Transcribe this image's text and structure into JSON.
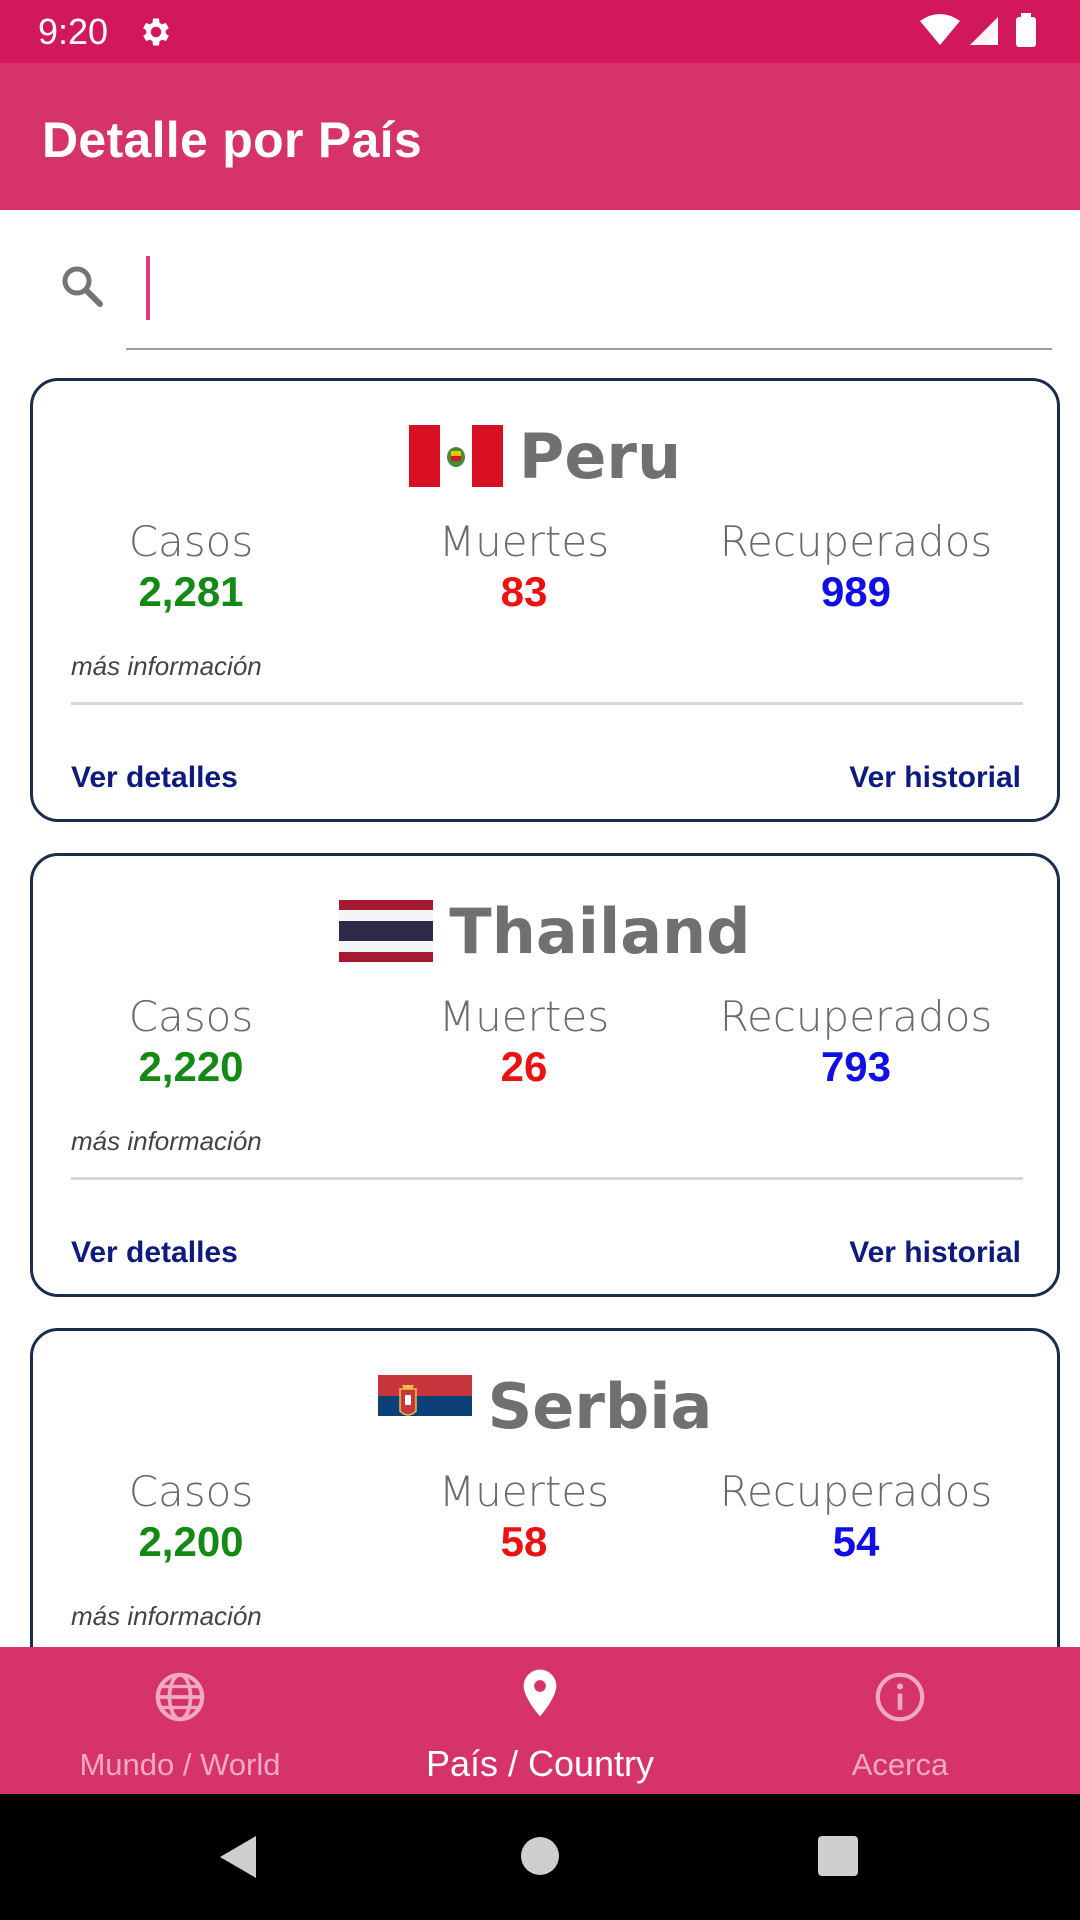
{
  "status_bar": {
    "time": "9:20",
    "gear_icon": "gear-icon",
    "icons": [
      "wifi-icon",
      "signal-icon",
      "battery-icon"
    ]
  },
  "app_bar": {
    "title": "Detalle por País"
  },
  "search": {
    "placeholder": "",
    "value": "",
    "icon": "search-icon"
  },
  "labels": {
    "cases": "Casos",
    "deaths": "Muertes",
    "recovered": "Recuperados",
    "more_info": "más información",
    "details": "Ver detalles",
    "history": "Ver historial"
  },
  "countries": [
    {
      "name": "Peru",
      "flag": "peru-flag-icon",
      "cases": "2,281",
      "deaths": "83",
      "recovered": "989"
    },
    {
      "name": "Thailand",
      "flag": "thailand-flag-icon",
      "cases": "2,220",
      "deaths": "26",
      "recovered": "793"
    },
    {
      "name": "Serbia",
      "flag": "serbia-flag-icon",
      "cases": "2,200",
      "deaths": "58",
      "recovered": "54"
    }
  ],
  "bottom_nav": [
    {
      "label": "Mundo / World",
      "icon": "globe-icon",
      "active": false
    },
    {
      "label": "País / Country",
      "icon": "location-pin-icon",
      "active": true
    },
    {
      "label": "Acerca",
      "icon": "info-icon",
      "active": false
    }
  ],
  "colors": {
    "status_bar": "#d0185a",
    "app_bar": "#d6336b",
    "cases": "#138a13",
    "deaths": "#ee1111",
    "recovered": "#1010e6",
    "link": "#0d1a80"
  }
}
